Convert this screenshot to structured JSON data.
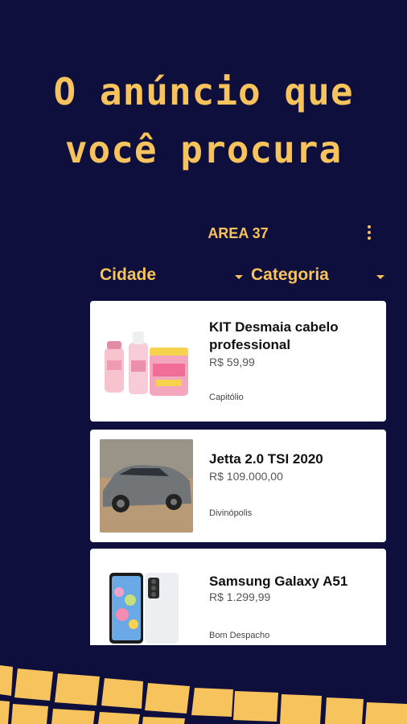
{
  "headline": {
    "line1": "O anúncio que",
    "line2": "você procura"
  },
  "app": {
    "title": "AREA 37",
    "filters": [
      {
        "label": "Cidade"
      },
      {
        "label": "Categoria"
      }
    ],
    "listings": [
      {
        "title": "KIT Desmaia cabelo professional",
        "price": "R$ 59,99",
        "city": "Capitólio",
        "image": "hair-products"
      },
      {
        "title": "Jetta 2.0 TSI 2020",
        "price": "R$ 109.000,00",
        "city": "Divinópolis",
        "image": "car"
      },
      {
        "title": "Samsung Galaxy A51",
        "price": "R$ 1.299,99",
        "city": "Bom Despacho",
        "image": "phone"
      }
    ]
  },
  "colors": {
    "background": "#0f0f3d",
    "accent": "#f7c35c",
    "card": "#ffffff"
  },
  "icons": {
    "menu": "more-vert-icon",
    "dropdown": "arrow-drop-down-icon"
  }
}
